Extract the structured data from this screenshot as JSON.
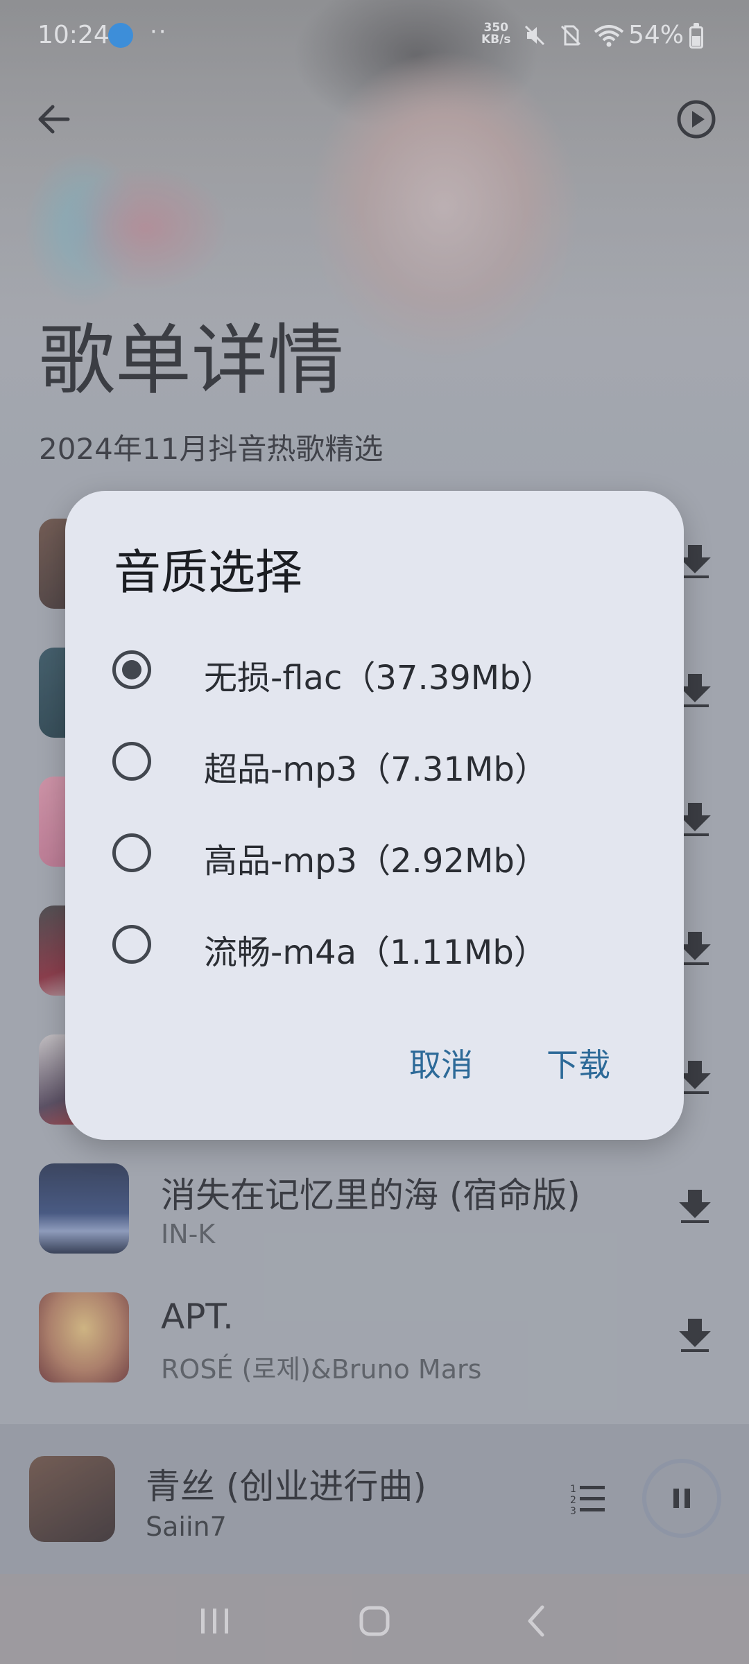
{
  "status_bar": {
    "time": "10:24",
    "dots": "··",
    "net_speed_value": "350",
    "net_speed_unit": "KB/s",
    "battery": "54%"
  },
  "header": {
    "title": "歌单详情",
    "subtitle": "2024年11月抖音热歌精选"
  },
  "songs": [
    {
      "title": "消失在记忆里的海 (宿命版)",
      "artist": "IN-K"
    },
    {
      "title": "APT.",
      "artist": "ROSÉ (로제)&Bruno Mars"
    }
  ],
  "now_playing": {
    "title": "青丝 (创业进行曲)",
    "artist": "Saiin7"
  },
  "dialog": {
    "title": "音质选择",
    "options": [
      {
        "label": "无损-flac（37.39Mb）",
        "selected": true
      },
      {
        "label": "超品-mp3（7.31Mb）",
        "selected": false
      },
      {
        "label": "高品-mp3（2.92Mb）",
        "selected": false
      },
      {
        "label": "流畅-m4a（1.11Mb）",
        "selected": false
      }
    ],
    "cancel_label": "取消",
    "confirm_label": "下载"
  },
  "colors": {
    "dialog_bg": "#e3e6ef",
    "accent": "#2d6a98",
    "radio": "#42474f"
  }
}
